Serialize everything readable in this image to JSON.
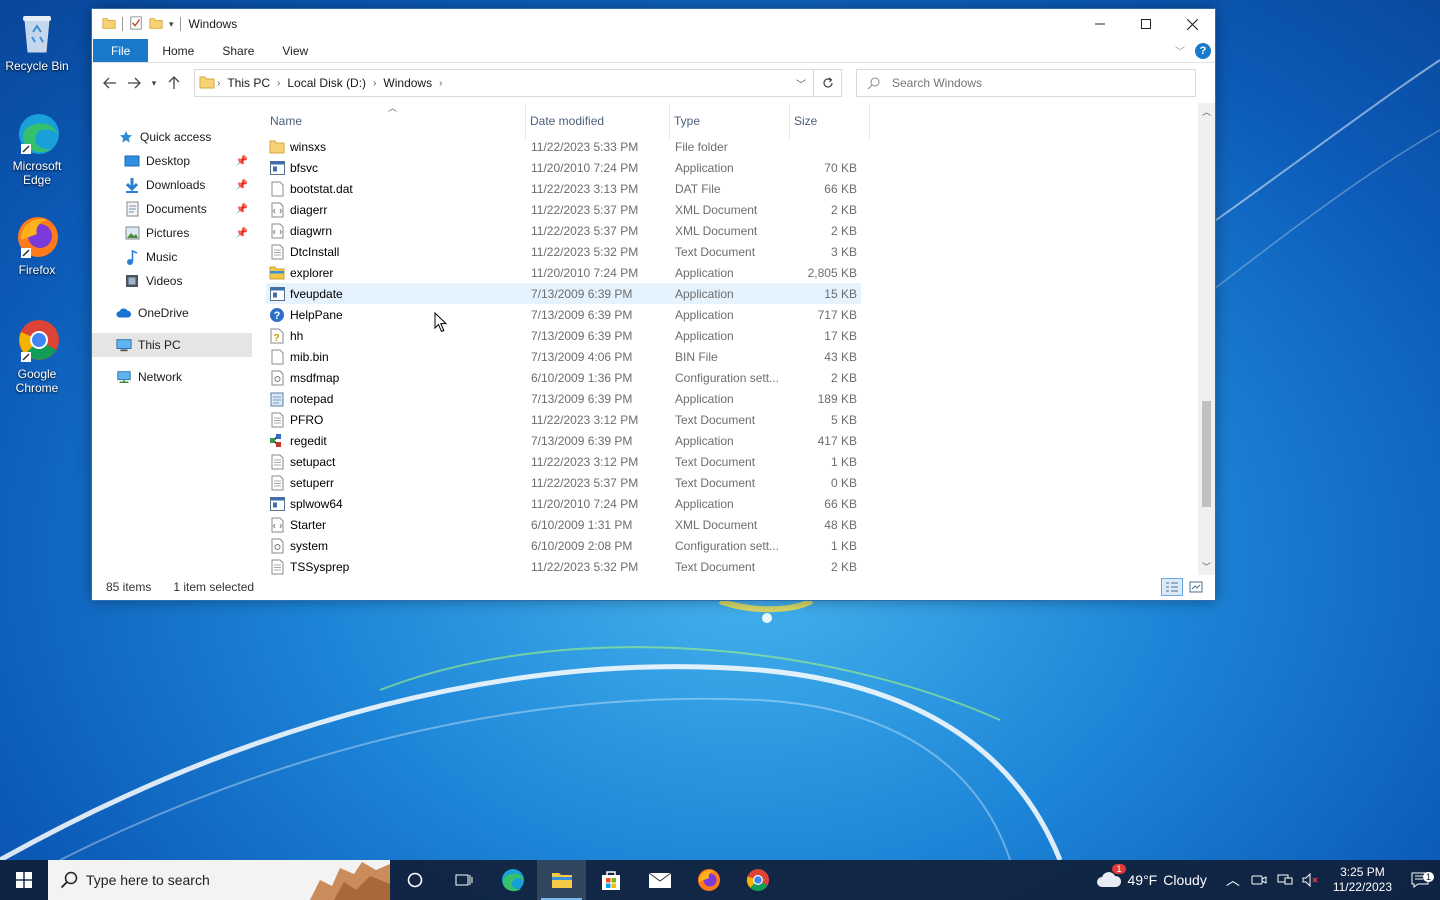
{
  "desktop": {
    "icons": [
      {
        "label": "Recycle Bin"
      },
      {
        "label": "Microsoft Edge"
      },
      {
        "label": "Firefox"
      },
      {
        "label": "Google Chrome"
      }
    ]
  },
  "window": {
    "title": "Windows",
    "ribbon_tabs": [
      "File",
      "Home",
      "Share",
      "View"
    ],
    "address": {
      "crumbs": [
        "This PC",
        "Local Disk (D:)",
        "Windows"
      ]
    },
    "search": {
      "placeholder": "Search Windows"
    },
    "nav": {
      "quick_access": "Quick access",
      "items": [
        {
          "label": "Desktop",
          "pinned": true
        },
        {
          "label": "Downloads",
          "pinned": true
        },
        {
          "label": "Documents",
          "pinned": true
        },
        {
          "label": "Pictures",
          "pinned": true
        },
        {
          "label": "Music",
          "pinned": false
        },
        {
          "label": "Videos",
          "pinned": false
        }
      ],
      "onedrive": "OneDrive",
      "this_pc": "This PC",
      "network": "Network"
    },
    "columns": {
      "name": "Name",
      "date": "Date modified",
      "type": "Type",
      "size": "Size"
    },
    "files": [
      {
        "name": "winsxs",
        "date": "11/22/2023 5:33 PM",
        "type": "File folder",
        "size": "",
        "icon": "folder-icon"
      },
      {
        "name": "bfsvc",
        "date": "11/20/2010 7:24 PM",
        "type": "Application",
        "size": "70 KB",
        "icon": "application-icon"
      },
      {
        "name": "bootstat.dat",
        "date": "11/22/2023 3:13 PM",
        "type": "DAT File",
        "size": "66 KB",
        "icon": "file-icon"
      },
      {
        "name": "diagerr",
        "date": "11/22/2023 5:37 PM",
        "type": "XML Document",
        "size": "2 KB",
        "icon": "xml-icon"
      },
      {
        "name": "diagwrn",
        "date": "11/22/2023 5:37 PM",
        "type": "XML Document",
        "size": "2 KB",
        "icon": "xml-icon"
      },
      {
        "name": "DtcInstall",
        "date": "11/22/2023 5:32 PM",
        "type": "Text Document",
        "size": "3 KB",
        "icon": "text-icon"
      },
      {
        "name": "explorer",
        "date": "11/20/2010 7:24 PM",
        "type": "Application",
        "size": "2,805 KB",
        "icon": "explorer-icon"
      },
      {
        "name": "fveupdate",
        "date": "7/13/2009 6:39 PM",
        "type": "Application",
        "size": "15 KB",
        "icon": "application-icon"
      },
      {
        "name": "HelpPane",
        "date": "7/13/2009 6:39 PM",
        "type": "Application",
        "size": "717 KB",
        "icon": "help-icon"
      },
      {
        "name": "hh",
        "date": "7/13/2009 6:39 PM",
        "type": "Application",
        "size": "17 KB",
        "icon": "help-file-icon"
      },
      {
        "name": "mib.bin",
        "date": "7/13/2009 4:06 PM",
        "type": "BIN File",
        "size": "43 KB",
        "icon": "file-icon"
      },
      {
        "name": "msdfmap",
        "date": "6/10/2009 1:36 PM",
        "type": "Configuration sett...",
        "size": "2 KB",
        "icon": "config-icon"
      },
      {
        "name": "notepad",
        "date": "7/13/2009 6:39 PM",
        "type": "Application",
        "size": "189 KB",
        "icon": "notepad-icon"
      },
      {
        "name": "PFRO",
        "date": "11/22/2023 3:12 PM",
        "type": "Text Document",
        "size": "5 KB",
        "icon": "text-icon"
      },
      {
        "name": "regedit",
        "date": "7/13/2009 6:39 PM",
        "type": "Application",
        "size": "417 KB",
        "icon": "regedit-icon"
      },
      {
        "name": "setupact",
        "date": "11/22/2023 3:12 PM",
        "type": "Text Document",
        "size": "1 KB",
        "icon": "text-icon"
      },
      {
        "name": "setuperr",
        "date": "11/22/2023 5:37 PM",
        "type": "Text Document",
        "size": "0 KB",
        "icon": "text-icon"
      },
      {
        "name": "splwow64",
        "date": "11/20/2010 7:24 PM",
        "type": "Application",
        "size": "66 KB",
        "icon": "application-icon"
      },
      {
        "name": "Starter",
        "date": "6/10/2009 1:31 PM",
        "type": "XML Document",
        "size": "48 KB",
        "icon": "xml-icon"
      },
      {
        "name": "system",
        "date": "6/10/2009 2:08 PM",
        "type": "Configuration sett...",
        "size": "1 KB",
        "icon": "config-icon"
      },
      {
        "name": "TSSysprep",
        "date": "11/22/2023 5:32 PM",
        "type": "Text Document",
        "size": "2 KB",
        "icon": "text-icon"
      }
    ],
    "status": {
      "count": "85 items",
      "selection": "1 item selected"
    }
  },
  "taskbar": {
    "search_placeholder": "Type here to search",
    "weather": {
      "temp": "49°F",
      "condition": "Cloudy",
      "badge": "1"
    },
    "clock": {
      "time": "3:25 PM",
      "date": "11/22/2023"
    },
    "notification_count": "1"
  },
  "colors": {
    "accent": "#1979ca",
    "hover_row": "#e5f3ff",
    "taskbar": "#102038"
  }
}
